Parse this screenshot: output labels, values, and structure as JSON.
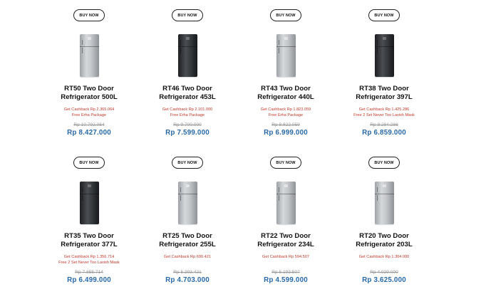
{
  "buy_label": "BUY NOW",
  "colors": {
    "promo": "#c0392b",
    "price": "#2a6aa9",
    "old_price": "#999999"
  },
  "products": [
    {
      "name_line1": "RT50 Two Door",
      "name_line2": "Refrigerator 500L",
      "promo_line1": "Get Cashback Rp 2.365.064",
      "promo_line2": "Free Erha Package",
      "old_price": "Rp 10.792.064",
      "price": "Rp 8.427.000",
      "finish": "silver"
    },
    {
      "name_line1": "RT46 Two Door",
      "name_line2": "Refrigerator 453L",
      "promo_line1": "Get Cashback Rp 2.101.000",
      "promo_line2": "Free Erha Package",
      "old_price": "Rp 9.700.000",
      "price": "Rp 7.599.000",
      "finish": "black"
    },
    {
      "name_line1": "RT43 Two Door",
      "name_line2": "Refrigerator 440L",
      "promo_line1": "Get Cashback Rp 1.823.059",
      "promo_line2": "Free Erha Package",
      "old_price": "Rp 8.822.059",
      "price": "Rp 6.999.000",
      "finish": "silver"
    },
    {
      "name_line1": "RT38 Two Door",
      "name_line2": "Refrigerator 397L",
      "promo_line1": "Get Cashback Rp 1.425.286",
      "promo_line2": "Free 2 Set Never Too Lavish Mask",
      "old_price": "Rp 8.284.286",
      "price": "Rp 6.859.000",
      "finish": "black"
    },
    {
      "name_line1": "RT35 Two Door",
      "name_line2": "Refrigerator 377L",
      "promo_line1": "Get Cashback Rp 1.356.714",
      "promo_line2": "Free 2 Set Never Too Lavish Mask",
      "old_price": "Rp 7.855.714",
      "price": "Rp 6.499.000",
      "finish": "black"
    },
    {
      "name_line1": "RT25 Two Door",
      "name_line2": "Refrigerator 255L",
      "promo_line1": "Get Cashback Rp 690.421",
      "promo_line2": "",
      "old_price": "Rp 5.393.421",
      "price": "Rp 4.703.000",
      "finish": "silver"
    },
    {
      "name_line1": "RT22 Two Door",
      "name_line2": "Refrigerator 234L",
      "promo_line1": "Get Cashback Rp 594.507",
      "promo_line2": "",
      "old_price": "Rp 5.193.507",
      "price": "Rp 4.599.000",
      "finish": "silver"
    },
    {
      "name_line1": "RT20 Two Door",
      "name_line2": "Refrigerator 203L",
      "promo_line1": "Get Cashback Rp 1.304.000",
      "promo_line2": "",
      "old_price": "Rp 4.929.000",
      "price": "Rp 3.625.000",
      "finish": "silver"
    }
  ]
}
